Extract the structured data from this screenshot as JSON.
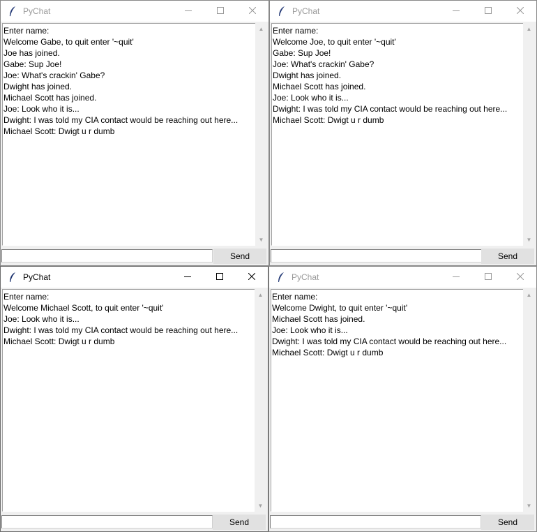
{
  "app": {
    "title": "PyChat",
    "send_label": "Send"
  },
  "windows": {
    "gabe": {
      "title": "PyChat",
      "messages": [
        "Enter name:",
        "Welcome Gabe, to quit enter '~quit'",
        "Joe has joined.",
        "Gabe: Sup Joe!",
        "Joe: What's crackin' Gabe?",
        "Dwight has joined.",
        "Michael Scott has joined.",
        "Joe: Look who it is...",
        "Dwight: I was told my CIA contact would be reaching out here...",
        "Michael Scott: Dwigt u r dumb"
      ],
      "input_value": "",
      "send_label": "Send"
    },
    "joe": {
      "title": "PyChat",
      "messages": [
        "Enter name:",
        "Welcome Joe, to quit enter '~quit'",
        "Gabe: Sup Joe!",
        "Joe: What's crackin' Gabe?",
        "Dwight has joined.",
        "Michael Scott has joined.",
        "Joe: Look who it is...",
        "Dwight: I was told my CIA contact would be reaching out here...",
        "Michael Scott: Dwigt u r dumb"
      ],
      "input_value": "",
      "send_label": "Send"
    },
    "michael": {
      "title": "PyChat",
      "messages": [
        "Enter name:",
        "Welcome Michael Scott, to quit enter '~quit'",
        "Joe: Look who it is...",
        "Dwight: I was told my CIA contact would be reaching out here...",
        "Michael Scott: Dwigt u r dumb"
      ],
      "input_value": "",
      "send_label": "Send"
    },
    "dwight": {
      "title": "PyChat",
      "messages": [
        "Enter name:",
        "Welcome Dwight, to quit enter '~quit'",
        "Michael Scott has joined.",
        "Joe: Look who it is...",
        "Dwight: I was told my CIA contact would be reaching out here...",
        "Michael Scott: Dwigt u r dumb"
      ],
      "input_value": "",
      "send_label": "Send"
    }
  },
  "icons": {
    "app_icon": "feather-icon",
    "minimize": "minimize-icon",
    "maximize": "maximize-icon",
    "close": "close-icon",
    "scroll_up": "scroll-up-arrow-icon",
    "scroll_down": "scroll-down-arrow-icon"
  },
  "colors": {
    "window_bg": "#f0f0f0",
    "titlebar_bg": "#ffffff",
    "inactive_title": "#999999",
    "active_title": "#000000",
    "button_bg": "#e1e1e1"
  },
  "active_window": "michael"
}
